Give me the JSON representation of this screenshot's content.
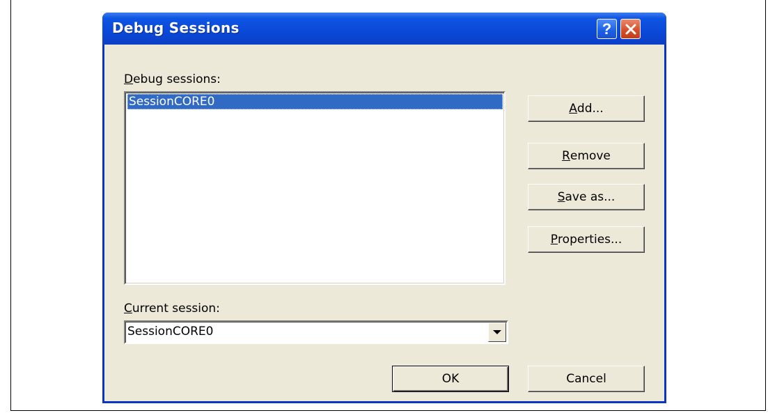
{
  "dialog": {
    "title": "Debug Sessions",
    "help_icon": "help-icon",
    "close_icon": "close-icon"
  },
  "sessions": {
    "label_mnemonic": "D",
    "label_rest": "ebug sessions:",
    "items": [
      "SessionCORE0"
    ],
    "selected_index": 0
  },
  "buttons": {
    "add": {
      "mnemonic": "A",
      "rest": "dd..."
    },
    "remove": {
      "mnemonic": "R",
      "rest": "emove"
    },
    "save_as": {
      "mnemonic": "S",
      "rest": "ave as..."
    },
    "properties": {
      "mnemonic": "P",
      "rest": "roperties..."
    },
    "ok": "OK",
    "cancel": "Cancel"
  },
  "current_session": {
    "label_mnemonic": "C",
    "label_rest": "urrent session:",
    "value": "SessionCORE0",
    "dropdown_icon": "chevron-down-icon"
  },
  "colors": {
    "titlebar": "#0a48d8",
    "client_bg": "#ece9d8",
    "selection": "#316ac5",
    "close_button": "#d6512b"
  }
}
